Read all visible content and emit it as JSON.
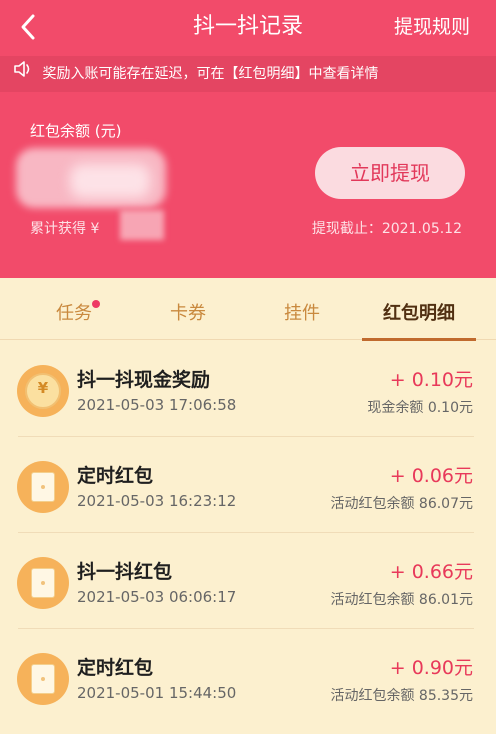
{
  "header": {
    "title": "抖一抖记录",
    "rules_label": "提现规则"
  },
  "notice": {
    "text": "奖励入账可能存在延迟，可在【红包明细】中查看详情"
  },
  "balance": {
    "label": "红包余额 (元)",
    "withdraw_label": "立即提现",
    "total_earned_label": "累计获得 ¥",
    "deadline_label": "提现截止：2021.05.12"
  },
  "tabs": [
    {
      "label": "任务",
      "active": false,
      "badge": true
    },
    {
      "label": "卡券",
      "active": false
    },
    {
      "label": "挂件",
      "active": false
    },
    {
      "label": "红包明细",
      "active": true
    }
  ],
  "records": [
    {
      "icon": "coin-icon",
      "title": "抖一抖现金奖励",
      "time": "2021-05-03 17:06:58",
      "amount": "+ 0.10元",
      "balance": "现金余额 0.10元"
    },
    {
      "icon": "envelope-icon",
      "title": "定时红包",
      "time": "2021-05-03 16:23:12",
      "amount": "+ 0.06元",
      "balance": "活动红包余额 86.07元"
    },
    {
      "icon": "envelope-icon",
      "title": "抖一抖红包",
      "time": "2021-05-03 06:06:17",
      "amount": "+ 0.66元",
      "balance": "活动红包余额 86.01元"
    },
    {
      "icon": "envelope-icon",
      "title": "定时红包",
      "time": "2021-05-01 15:44:50",
      "amount": "+ 0.90元",
      "balance": "活动红包余额 85.35元"
    }
  ],
  "colors": {
    "header_bg": "#f24b6a",
    "page_bg": "#fcf0cf",
    "amount": "#e8395a",
    "tab_active": "#513012",
    "tab_inactive": "#c9893e"
  }
}
